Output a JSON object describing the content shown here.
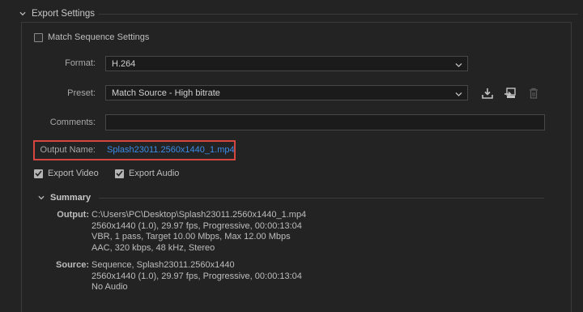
{
  "section": {
    "title": "Export Settings"
  },
  "match_sequence": {
    "label": "Match Sequence Settings",
    "checked": false
  },
  "format": {
    "label": "Format:",
    "value": "H.264"
  },
  "preset": {
    "label": "Preset:",
    "value": "Match Source - High bitrate",
    "icons": [
      "save-preset-icon",
      "import-preset-icon",
      "delete-preset-icon"
    ]
  },
  "comments": {
    "label": "Comments:",
    "value": ""
  },
  "output_name": {
    "label": "Output Name:",
    "value": "Splash23011.2560x1440_1.mp4",
    "highlight_color": "#d6453f",
    "link_color": "#3b8de8"
  },
  "export_video": {
    "label": "Export Video",
    "checked": true
  },
  "export_audio": {
    "label": "Export Audio",
    "checked": true
  },
  "summary": {
    "title": "Summary",
    "output": {
      "key": "Output:",
      "lines": [
        "C:\\Users\\PC\\Desktop\\Splash23011.2560x1440_1.mp4",
        "2560x1440 (1.0), 29.97 fps, Progressive, 00:00:13:04",
        "VBR, 1 pass, Target 10.00 Mbps, Max 12.00 Mbps",
        "AAC, 320 kbps, 48 kHz, Stereo"
      ]
    },
    "source": {
      "key": "Source:",
      "lines": [
        "Sequence, Splash23011.2560x1440",
        "2560x1440 (1.0), 29.97 fps, Progressive, 00:00:13:04",
        "No Audio"
      ]
    }
  }
}
